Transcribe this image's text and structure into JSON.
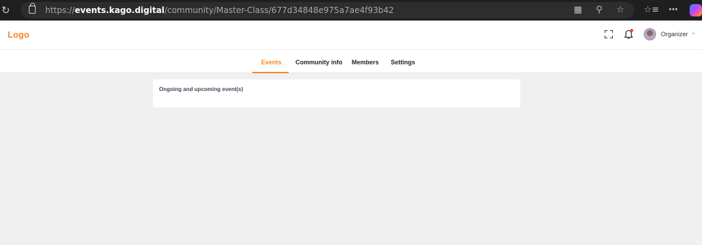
{
  "browser": {
    "url_scheme": "https://",
    "url_host": "events.kago.digital",
    "url_path": "/community/Master-Class/677d34848e975a7ae4f93b42",
    "icons": [
      "reload-icon",
      "lock-icon",
      "split-screen-icon",
      "zoom-icon",
      "favorite-star-icon",
      "favorites-list-icon",
      "more-icon",
      "copilot-icon"
    ]
  },
  "header": {
    "logo": "Logo",
    "user_role": "Organizer",
    "accent_color": "#f7892b",
    "notification_dot_color": "#e53935"
  },
  "tabs": [
    {
      "label": "Events",
      "active": true
    },
    {
      "label": "Community info",
      "active": false
    },
    {
      "label": "Members",
      "active": false
    },
    {
      "label": "Settings",
      "active": false
    }
  ],
  "main": {
    "section_title": "Ongoing and upcoming event(s)"
  }
}
